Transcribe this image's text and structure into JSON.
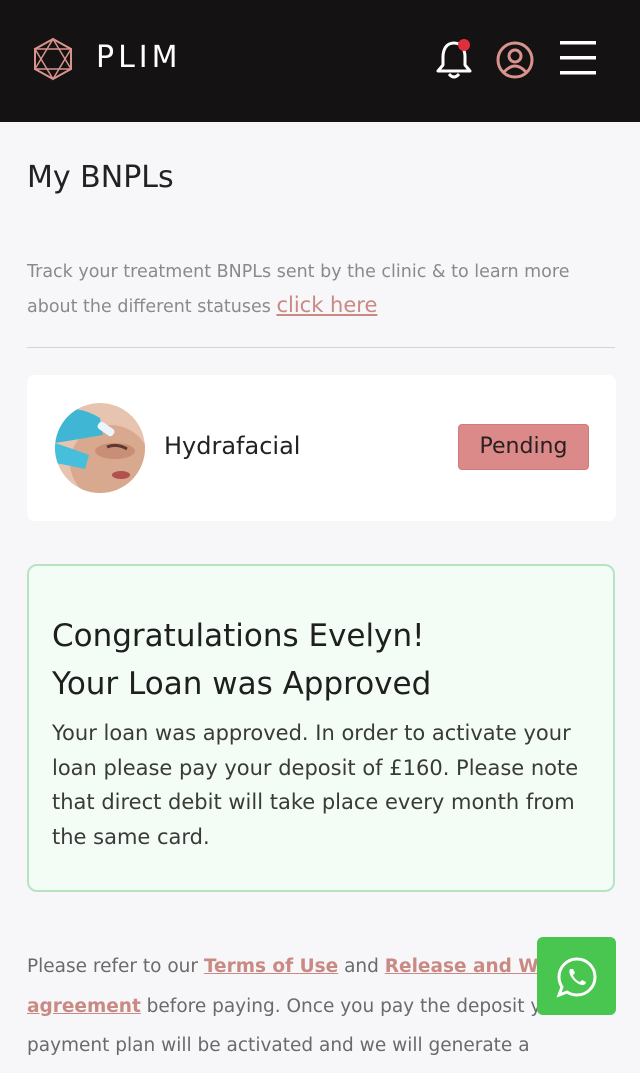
{
  "header": {
    "brand": "PLIM",
    "icons": [
      "hexagon-logo-icon",
      "bell-icon",
      "profile-icon",
      "menu-icon"
    ],
    "notification_dot_color": "#e02e3c"
  },
  "page": {
    "title": "My BNPLs",
    "intro_text": "Track your treatment BNPLs sent by the clinic & to learn more about the different statuses ",
    "intro_link": "click here"
  },
  "treatment": {
    "name": "Hydrafacial",
    "status": "Pending",
    "status_color": "#dc898a"
  },
  "approval": {
    "title_line1": "Congratulations Evelyn!",
    "title_line2": "Your Loan was Approved",
    "body": "Your loan was approved. In order to activate your loan please pay your deposit of £160. Please note that direct debit will take place every month from the same card."
  },
  "footer": {
    "text_before": "Please refer to our ",
    "terms_link": "Terms of Use",
    "text_and": " and ",
    "release_link": "Release and Waiver agreement",
    "text_after": " before paying. Once you pay the deposit your payment plan will be activated and we will generate a"
  },
  "whatsapp": {
    "icon": "whatsapp-icon",
    "color": "#49c64f"
  }
}
